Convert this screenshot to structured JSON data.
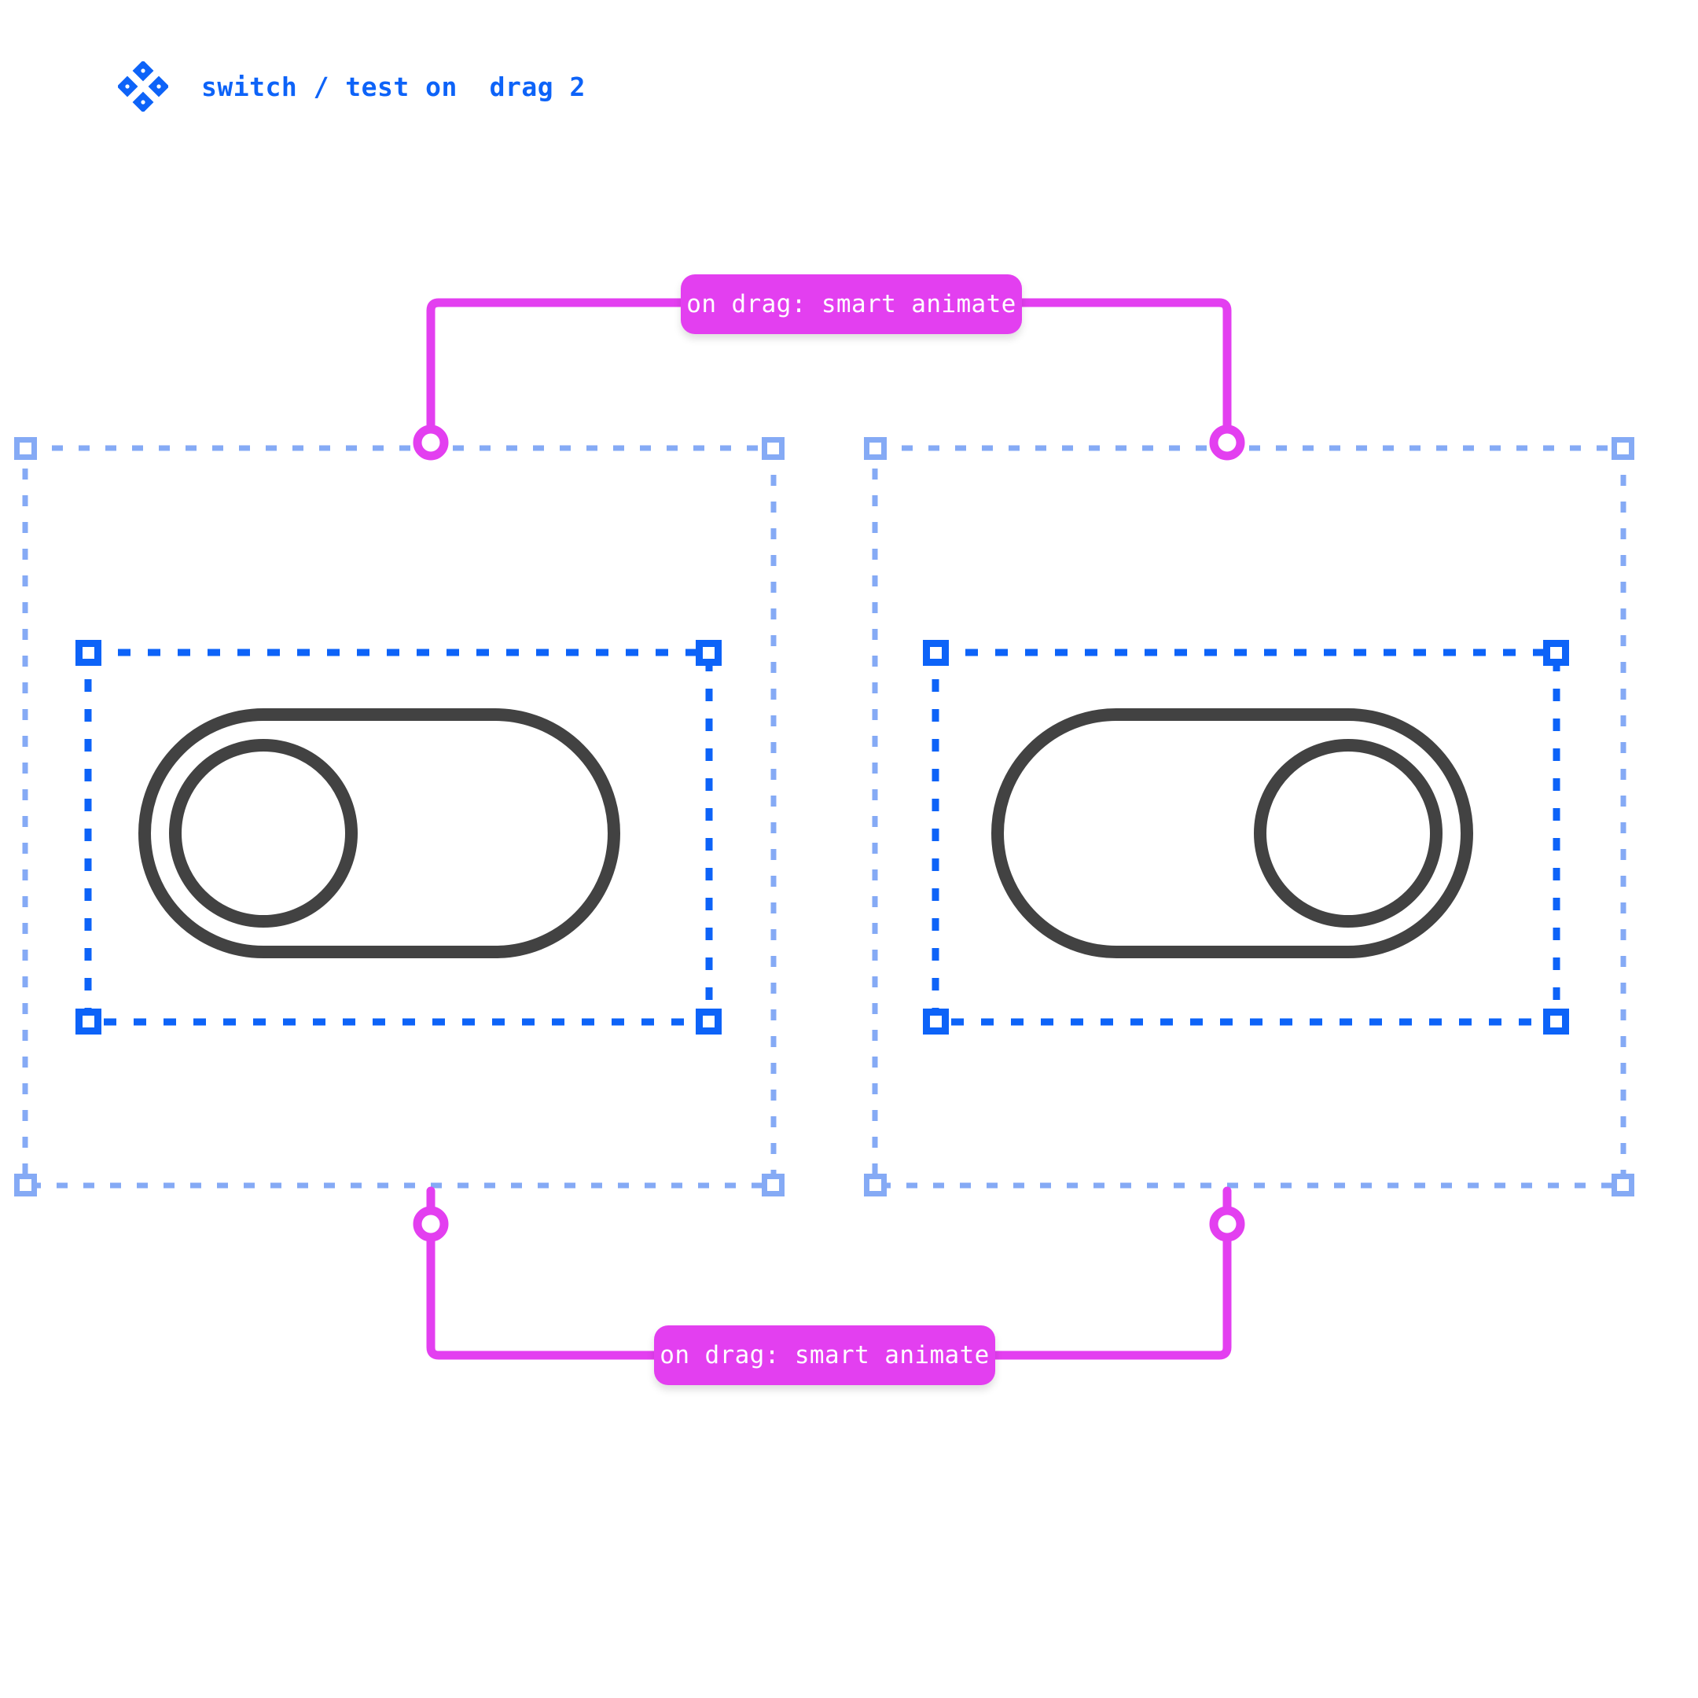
{
  "header": {
    "icon": "diamond-cluster-icon",
    "title": "switch / test on  drag 2",
    "color": "#0d63f8"
  },
  "canvas": {
    "background": "#ffffff",
    "outer_frame_color": "#85aaf5",
    "inner_frame_color": "#0d63f8",
    "connector_color": "#e33ff0",
    "switch_stroke_color": "#424242"
  },
  "connectors": [
    {
      "name": "top-connector",
      "badge_label": "on drag: smart animate",
      "from_node": "frame-off-top",
      "to_node": "frame-on-top",
      "endpoint_shape": "ring"
    },
    {
      "name": "bottom-connector",
      "badge_label": "on drag: smart animate",
      "from_node": "frame-off-bottom",
      "to_node": "frame-on-bottom",
      "endpoint_shape": "ring"
    }
  ],
  "frames": [
    {
      "name": "frame-off",
      "selection": "outer",
      "component": {
        "name": "switch-off",
        "state": "off",
        "knob_position": "left",
        "stroke": "#424242"
      }
    },
    {
      "name": "frame-on",
      "selection": "outer",
      "component": {
        "name": "switch-on",
        "state": "on",
        "knob_position": "right",
        "stroke": "#424242"
      }
    }
  ],
  "badges": {
    "top": {
      "label": "on drag: smart animate"
    },
    "bottom": {
      "label": "on drag: smart animate"
    }
  }
}
